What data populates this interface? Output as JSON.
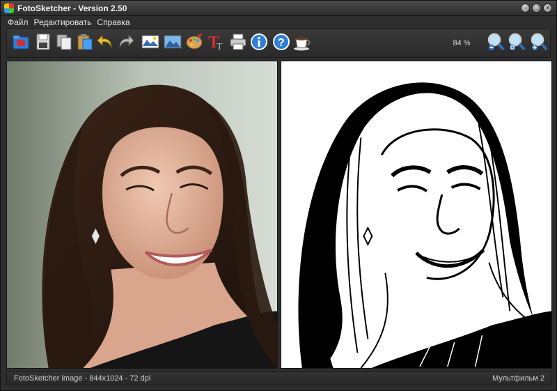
{
  "window": {
    "title": "FotoSketcher - Version 2.50"
  },
  "menu": {
    "items": [
      "Файл",
      "Редактировать",
      "Справка"
    ]
  },
  "toolbar": {
    "zoom_value": "84 %"
  },
  "status": {
    "left": "FotoSketcher image - 844x1024 - 72 dpi",
    "right": "Мультфильм 2"
  },
  "icons": [
    "open-folder-icon",
    "save-icon",
    "copy-icon",
    "paste-icon",
    "undo-icon",
    "redo-icon",
    "image-effect-icon",
    "landscape-icon",
    "palette-icon",
    "text-icon",
    "print-icon",
    "info-icon",
    "help-icon",
    "coffee-icon",
    "zoom-out-icon",
    "zoom-fit-icon",
    "zoom-in-icon"
  ],
  "colors": {
    "background": "#2e2e2e",
    "panel_border": "#151515",
    "accent_blue": "#2f7fd8"
  }
}
